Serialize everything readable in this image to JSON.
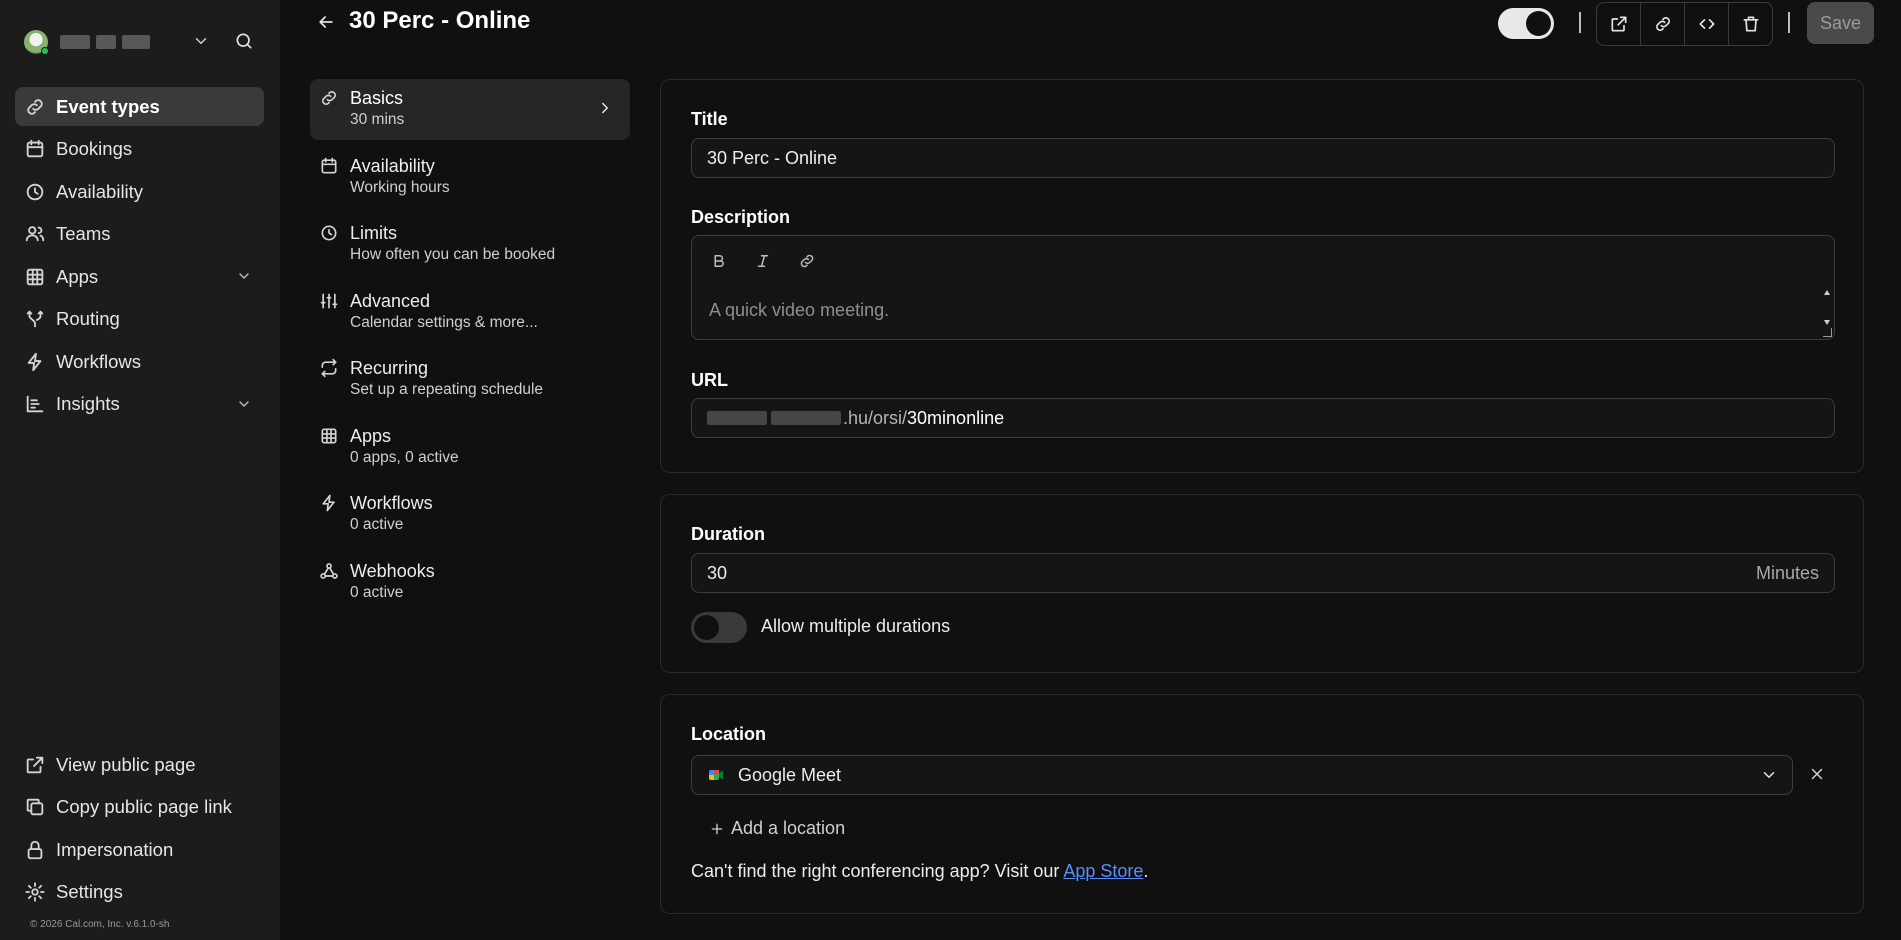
{
  "header": {
    "title": "30 Perc - Online",
    "save_label": "Save"
  },
  "sidebar": {
    "items": [
      {
        "label": "Event types",
        "icon": "link-icon"
      },
      {
        "label": "Bookings",
        "icon": "calendar-icon"
      },
      {
        "label": "Availability",
        "icon": "clock-icon"
      },
      {
        "label": "Teams",
        "icon": "users-icon"
      },
      {
        "label": "Apps",
        "icon": "grid-icon"
      },
      {
        "label": "Routing",
        "icon": "split-icon"
      },
      {
        "label": "Workflows",
        "icon": "zap-icon"
      },
      {
        "label": "Insights",
        "icon": "bar-chart-icon"
      }
    ],
    "bottom_items": [
      {
        "label": "View public page",
        "icon": "external-link-icon"
      },
      {
        "label": "Copy public page link",
        "icon": "copy-icon"
      },
      {
        "label": "Impersonation",
        "icon": "lock-icon"
      },
      {
        "label": "Settings",
        "icon": "gear-icon"
      }
    ],
    "copyright": "© 2026 Cal.com, Inc. v.6.1.0-sh"
  },
  "subnav": {
    "items": [
      {
        "title": "Basics",
        "subtitle": "30 mins"
      },
      {
        "title": "Availability",
        "subtitle": "Working hours"
      },
      {
        "title": "Limits",
        "subtitle": "How often you can be booked"
      },
      {
        "title": "Advanced",
        "subtitle": "Calendar settings & more..."
      },
      {
        "title": "Recurring",
        "subtitle": "Set up a repeating schedule"
      },
      {
        "title": "Apps",
        "subtitle": "0 apps, 0 active"
      },
      {
        "title": "Workflows",
        "subtitle": "0 active"
      },
      {
        "title": "Webhooks",
        "subtitle": "0 active"
      }
    ]
  },
  "form": {
    "title_label": "Title",
    "title_value": "30 Perc - Online",
    "description_label": "Description",
    "description_placeholder": "A quick video meeting.",
    "url_label": "URL",
    "url_prefix": ".hu/orsi/",
    "url_slug": "30minonline",
    "duration_label": "Duration",
    "duration_value": "30",
    "duration_unit": "Minutes",
    "multiple_durations_label": "Allow multiple durations",
    "location_label": "Location",
    "location_value": "Google Meet",
    "add_location_label": "Add a location",
    "helper_text": "Can't find the right conferencing app? Visit our ",
    "helper_link": "App Store",
    "helper_end": "."
  },
  "colors": {
    "background": "#101010",
    "sidebar": "#1c1c1c",
    "link": "#5a8dff",
    "online_status": "#22c55e"
  }
}
